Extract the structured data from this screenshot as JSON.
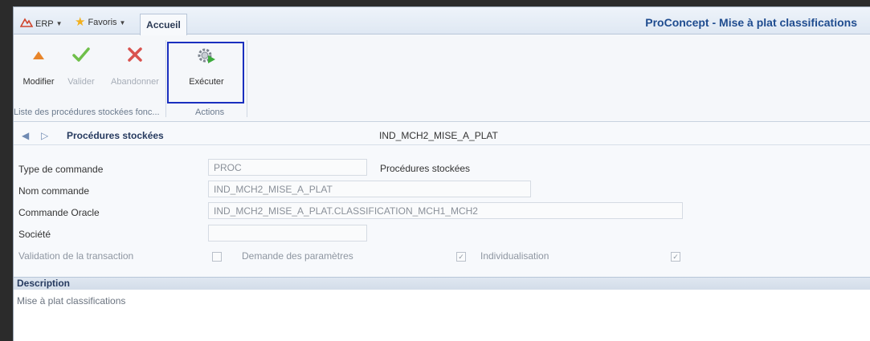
{
  "titlebar": {
    "erp_label": "ERP",
    "favorites_label": "Favoris",
    "active_tab": "Accueil",
    "app_title": "ProConcept - Mise à plat classifications"
  },
  "ribbon": {
    "modifier": "Modifier",
    "valider": "Valider",
    "abandonner": "Abandonner",
    "executer": "Exécuter",
    "group1_label": "Liste des procédures stockées fonc...",
    "group2_label": "Actions"
  },
  "nav": {
    "title": "Procédures stockées",
    "record": "IND_MCH2_MISE_A_PLAT"
  },
  "form": {
    "type_label": "Type de commande",
    "type_value": "PROC",
    "type_desc": "Procédures stockées",
    "nom_label": "Nom commande",
    "nom_value": "IND_MCH2_MISE_A_PLAT",
    "oracle_label": "Commande Oracle",
    "oracle_value": "IND_MCH2_MISE_A_PLAT.CLASSIFICATION_MCH1_MCH2",
    "societe_label": "Société",
    "societe_value": "",
    "validation_label": "Validation de la transaction",
    "demande_label": "Demande des paramètres",
    "indiv_label": "Individualisation",
    "validation_checked": false,
    "demande_checked": true,
    "indiv_checked": true
  },
  "description": {
    "header": "Description",
    "text": "Mise à plat classifications"
  },
  "colors": {
    "accent": "#1f4c8f",
    "highlight_border": "#1a2fbf",
    "erp_icon": "#d0452c",
    "favorites_star": "#f2b01e",
    "modify_icon": "#e8852a",
    "validate_icon": "#6fbf4a",
    "cancel_icon": "#d9534f"
  },
  "icons": {
    "erp": "erp-icon",
    "favorites": "star-icon",
    "modifier": "triangle-icon",
    "valider": "checkmark-icon",
    "abandonner": "x-icon",
    "executer": "gear-play-icon",
    "nav_prev": "arrow-left-icon",
    "nav_next": "arrow-right-icon"
  }
}
